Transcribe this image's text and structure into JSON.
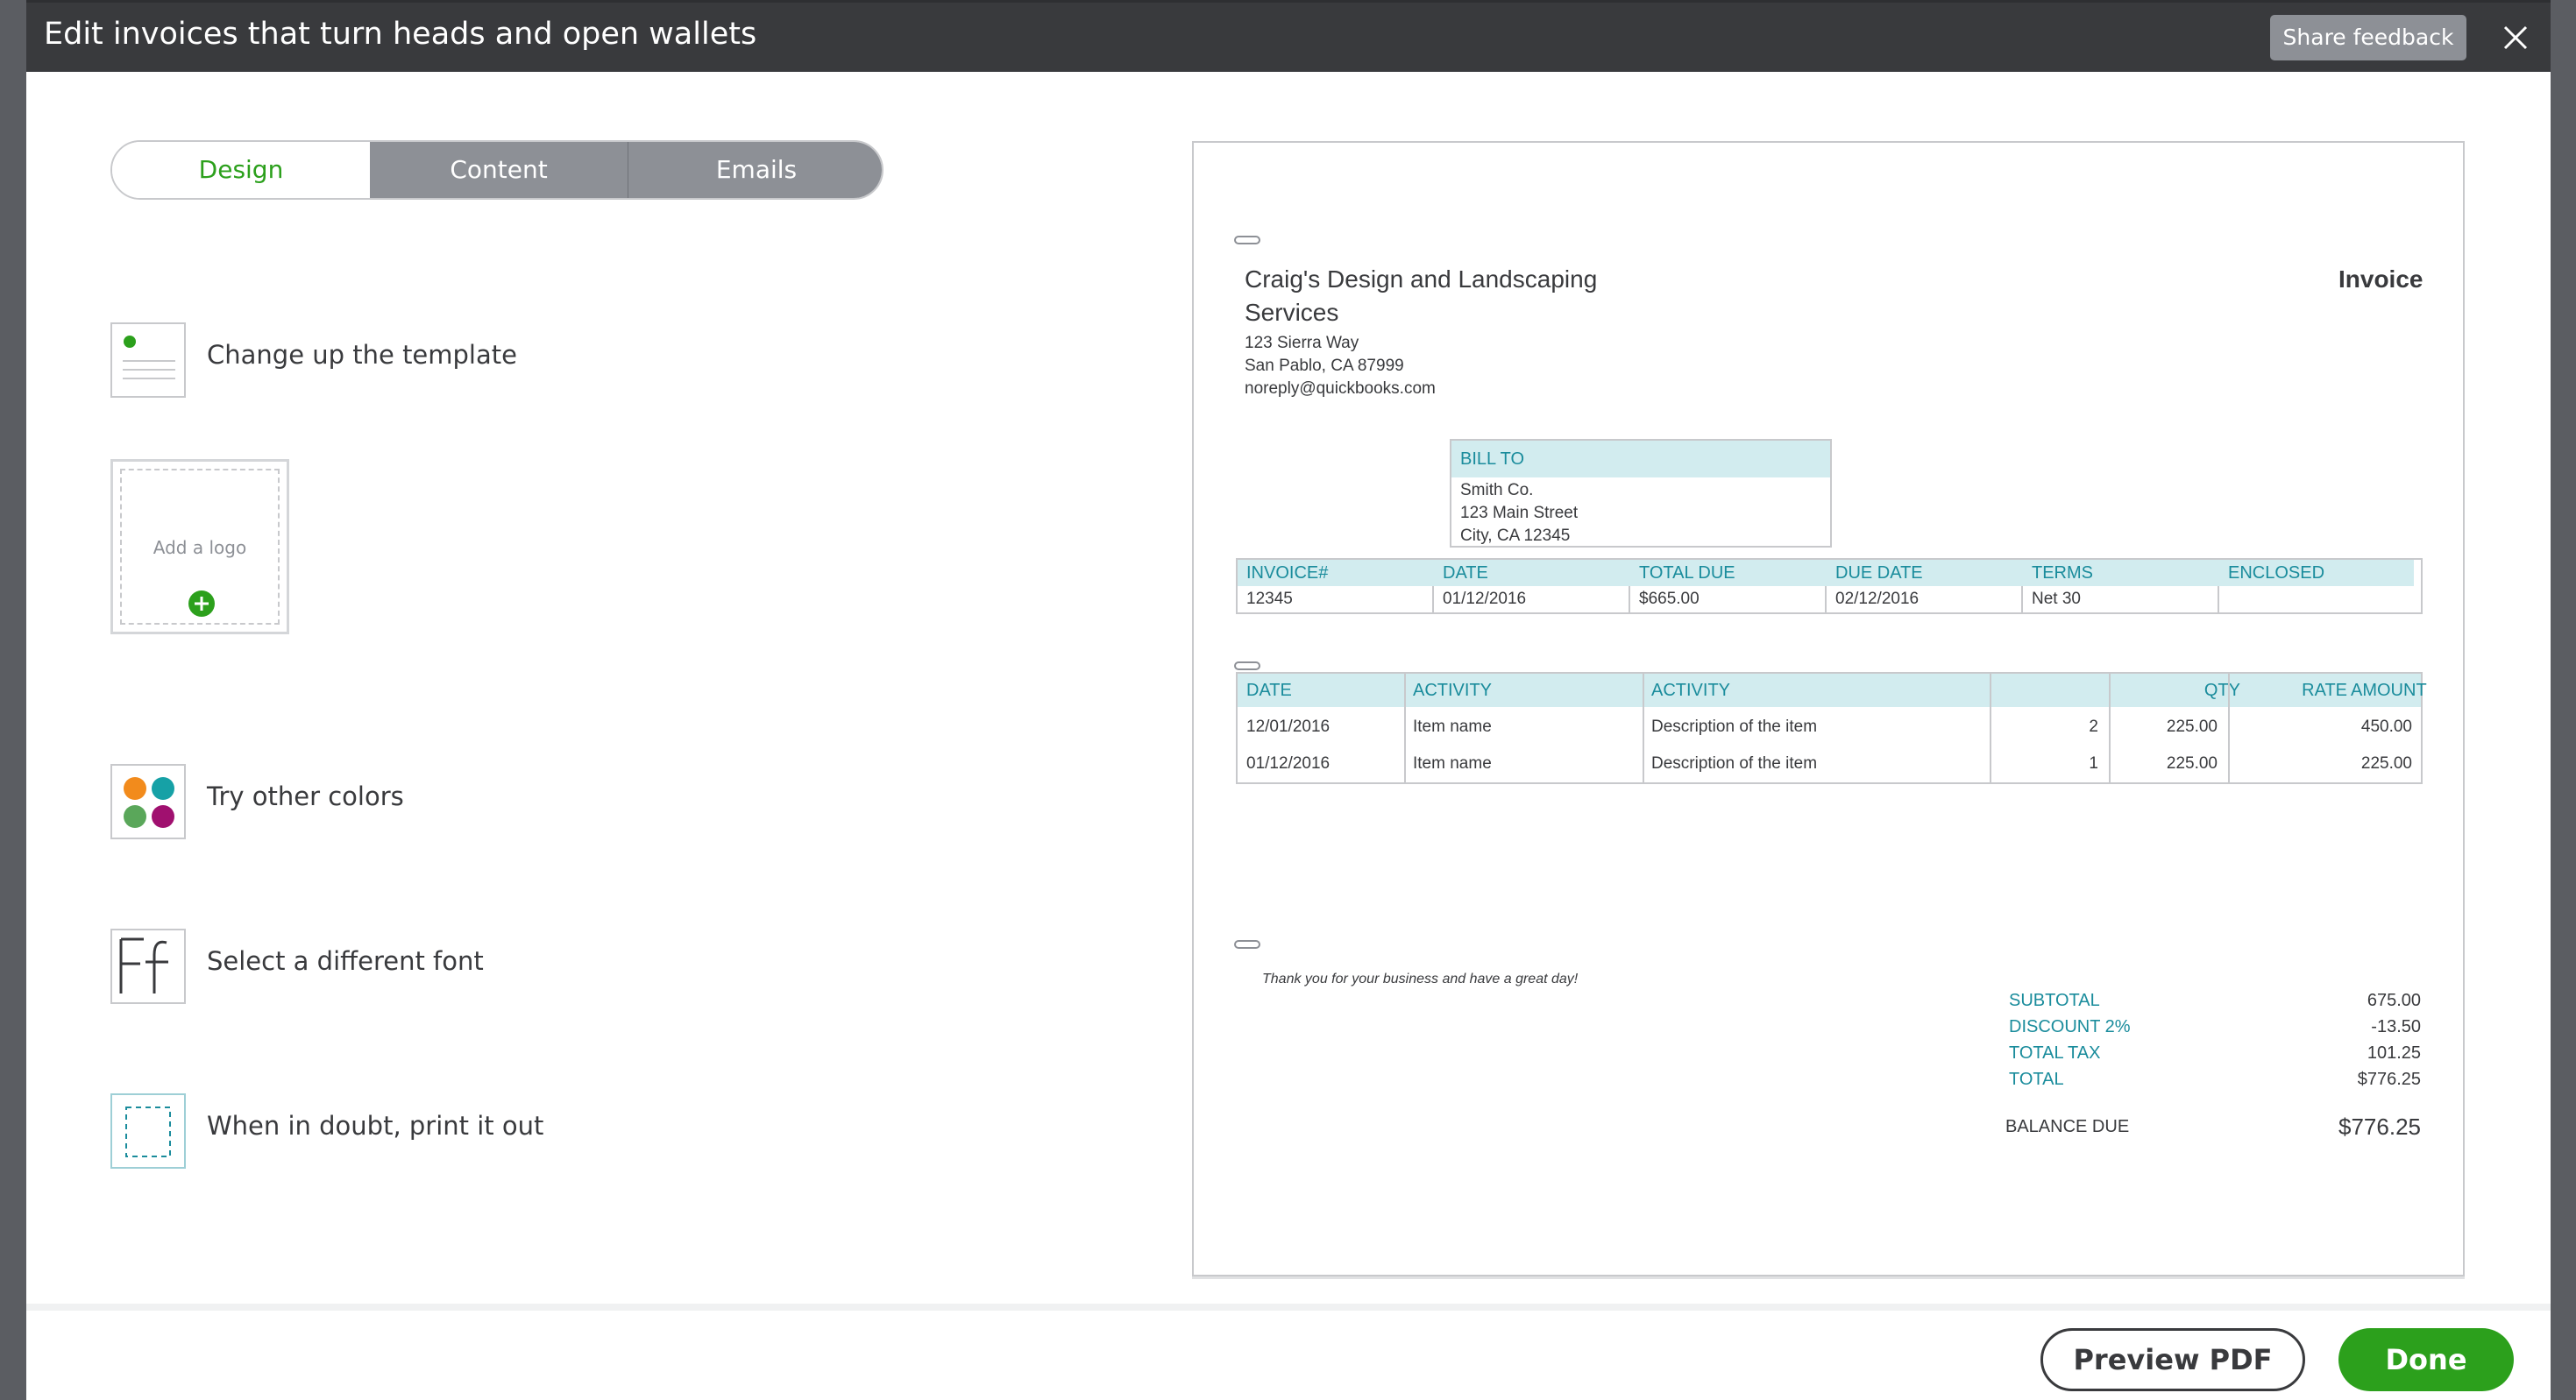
{
  "header": {
    "title": "Edit invoices that turn heads and open wallets",
    "share_feedback": "Share feedback"
  },
  "tabs": [
    "Design",
    "Content",
    "Emails"
  ],
  "options": {
    "template": "Change up the template",
    "add_logo": "Add a logo",
    "colors": "Try other colors",
    "font": "Select a different font",
    "print": "When in doubt, print it out"
  },
  "invoice": {
    "company_name_1": "Craig's Design and Landscaping",
    "company_name_2": "Services",
    "address_1": "123 Sierra Way",
    "address_2": "San Pablo, CA 87999",
    "email": "noreply@quickbooks.com",
    "doc_title": "Invoice",
    "bill_to_label": "BILL TO",
    "bill_to_1": "Smith Co.",
    "bill_to_2": "123 Main Street",
    "bill_to_3": "City, CA 12345",
    "info_headers": [
      "INVOICE#",
      "DATE",
      "TOTAL DUE",
      "DUE DATE",
      "TERMS",
      "ENCLOSED"
    ],
    "info_values": [
      "12345",
      "01/12/2016",
      "$665.00",
      "02/12/2016",
      "Net 30",
      ""
    ],
    "line_headers": [
      "DATE",
      "ACTIVITY",
      "ACTIVITY",
      "QTY",
      "RATE",
      "AMOUNT"
    ],
    "lines": [
      [
        "12/01/2016",
        "Item name",
        "Description of the item",
        "2",
        "225.00",
        "450.00"
      ],
      [
        "01/12/2016",
        "Item name",
        "Description of the item",
        "1",
        "225.00",
        "225.00"
      ]
    ],
    "message": "Thank you for your business and have a great day!",
    "totals": [
      {
        "label": "SUBTOTAL",
        "value": "675.00"
      },
      {
        "label": "DISCOUNT 2%",
        "value": "-13.50"
      },
      {
        "label": "TOTAL TAX",
        "value": "101.25"
      },
      {
        "label": "TOTAL",
        "value": "$776.25"
      }
    ],
    "balance_label": "BALANCE DUE",
    "balance_value": "$776.25"
  },
  "footer": {
    "preview_pdf": "Preview PDF",
    "done": "Done"
  },
  "colors": {
    "accent_green": "#2ca01c",
    "teal": "#1a8c9c",
    "dark": "#393a3d",
    "swatches": [
      "#f28b1c",
      "#16a1a6",
      "#5aa75a",
      "#a0106f"
    ]
  }
}
